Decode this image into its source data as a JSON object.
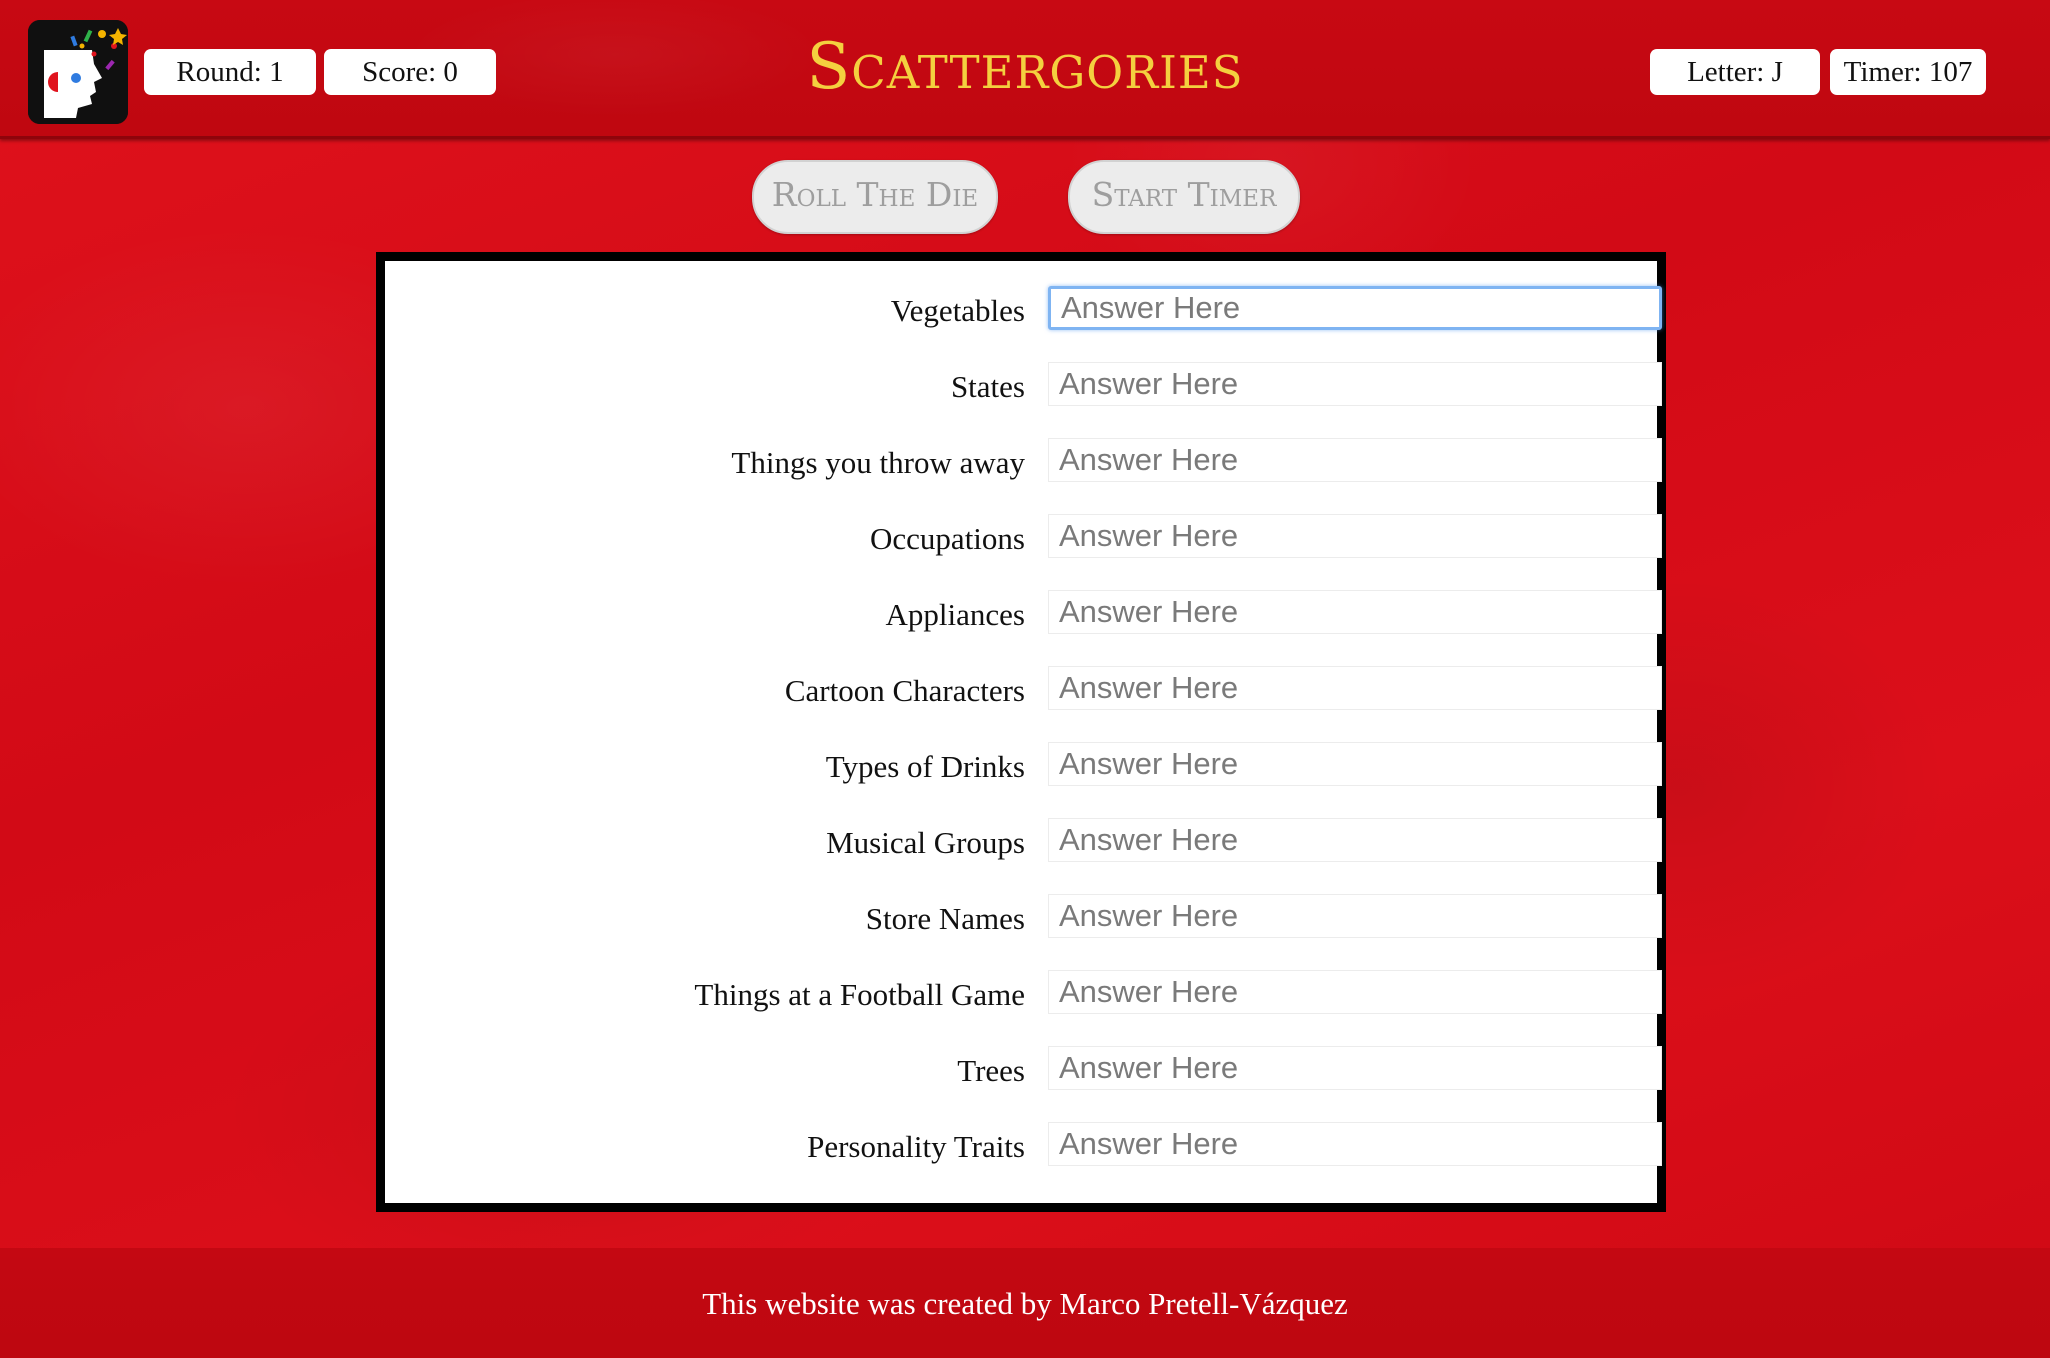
{
  "app": {
    "title": "Scattergories"
  },
  "header": {
    "round": "Round: 1",
    "score": "Score: 0",
    "letter": "Letter: J",
    "timer": "Timer: 107",
    "logo_icon": "head-with-confetti-icon"
  },
  "controls": {
    "roll_label": "Roll The Die",
    "timer_label": "Start Timer"
  },
  "answers": {
    "placeholder": "Answer Here",
    "focused_index": 0,
    "categories": [
      "Vegetables",
      "States",
      "Things you throw away",
      "Occupations",
      "Appliances",
      "Cartoon Characters",
      "Types of Drinks",
      "Musical Groups",
      "Store Names",
      "Things at a Football Game",
      "Trees",
      "Personality Traits"
    ]
  },
  "footer": {
    "credit": "This website was created by Marco Pretell-Vázquez"
  },
  "colors": {
    "background": "#d80c18",
    "header": "#c90812",
    "title": "#f4d03f",
    "focus_ring": "#7fb4f2"
  }
}
